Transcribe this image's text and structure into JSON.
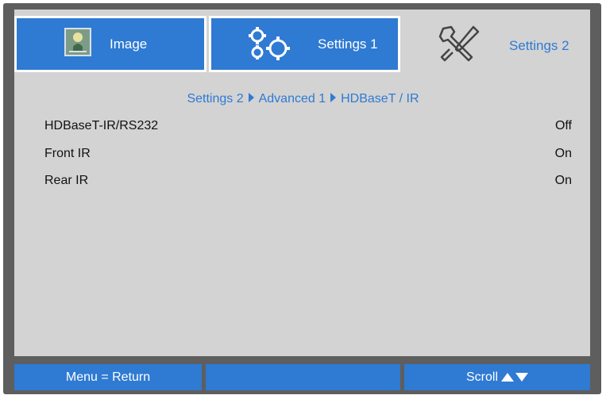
{
  "tabs": [
    {
      "label": "Image",
      "icon": "image-icon",
      "active": false
    },
    {
      "label": "Settings 1",
      "icon": "gears-icon",
      "active": false
    },
    {
      "label": "Settings 2",
      "icon": "tools-icon",
      "active": true
    }
  ],
  "breadcrumb": {
    "part1": "Settings 2",
    "part2": "Advanced 1",
    "part3": "HDBaseT / IR"
  },
  "settings": [
    {
      "label": "HDBaseT-IR/RS232",
      "value": "Off"
    },
    {
      "label": "Front IR",
      "value": "On"
    },
    {
      "label": "Rear IR",
      "value": "On"
    }
  ],
  "footer": {
    "left": "Menu = Return",
    "middle": "",
    "right": "Scroll"
  },
  "colors": {
    "accent": "#2f7ad3",
    "frame": "#5e5e5e",
    "panel": "#d3d3d3"
  }
}
